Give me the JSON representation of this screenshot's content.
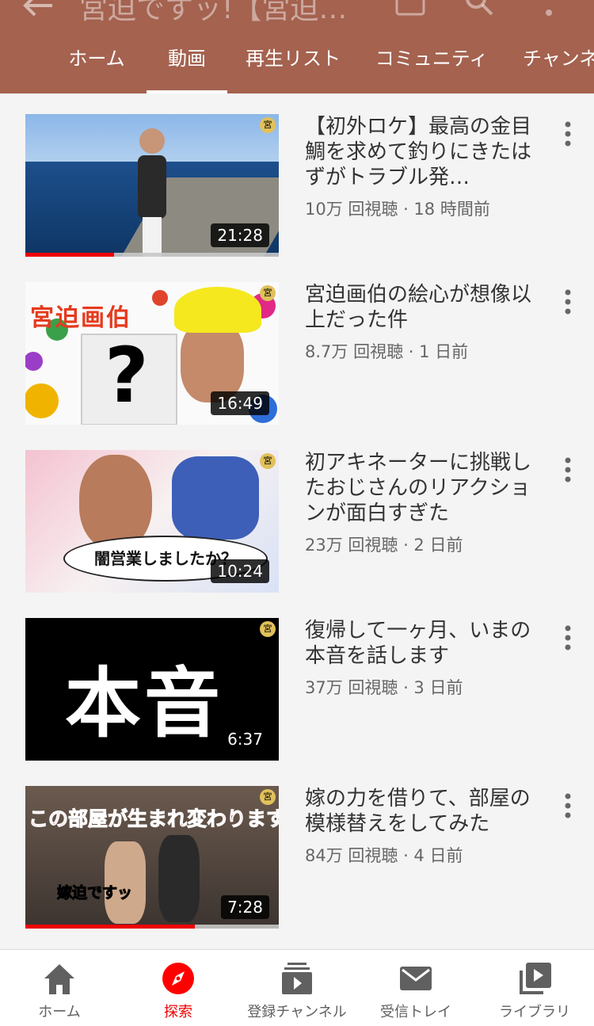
{
  "header": {
    "title": "宮迫ですッ!【宮迫…",
    "tabs": [
      {
        "label": "ホーム",
        "active": false
      },
      {
        "label": "動画",
        "active": true
      },
      {
        "label": "再生リスト",
        "active": false
      },
      {
        "label": "コミュニティ",
        "active": false
      },
      {
        "label": "チャンネル",
        "active": false
      }
    ],
    "icons": [
      "arrow-back-icon",
      "cast-icon",
      "search-icon",
      "more-vert-icon"
    ],
    "bg_color": "#a4624f"
  },
  "videos": [
    {
      "title": "【初外ロケ】最高の金目鯛を求めて釣りにきたはずがトラブル発…",
      "meta": "10万 回視聴 · 18 時間前",
      "duration": "21:28",
      "progress": 0.35,
      "badge": "宮"
    },
    {
      "title": "宮迫画伯の絵心が想像以上だった件",
      "meta": "8.7万 回視聴 · 1 日前",
      "duration": "16:49",
      "thumb_text": "宮迫画伯",
      "thumb_glyph": "?",
      "badge": "宮"
    },
    {
      "title": "初アキネーターに挑戦したおじさんのリアクションが面白すぎた",
      "meta": "23万 回視聴 · 2 日前",
      "duration": "10:24",
      "thumb_text": "闇営業しましたか？",
      "badge": "宮"
    },
    {
      "title": "復帰して一ヶ月、いまの本音を話します",
      "meta": "37万 回視聴 · 3 日前",
      "duration": "6:37",
      "thumb_text": "本音",
      "badge": "宮"
    },
    {
      "title": "嫁の力を借りて、部屋の模様替えをしてみた",
      "meta": "84万 回視聴 · 4 日前",
      "duration": "7:28",
      "progress": 0.67,
      "thumb_text": "この部屋が生まれ変わります",
      "thumb_label": "嫁迫ですッ",
      "badge": "宮"
    }
  ],
  "bottom_nav": [
    {
      "label": "ホーム",
      "icon": "home-icon",
      "active": false
    },
    {
      "label": "探索",
      "icon": "explore-icon",
      "active": true
    },
    {
      "label": "登録チャンネル",
      "icon": "subscriptions-icon",
      "active": false
    },
    {
      "label": "受信トレイ",
      "icon": "inbox-icon",
      "active": false
    },
    {
      "label": "ライブラリ",
      "icon": "library-icon",
      "active": false
    }
  ],
  "colors": {
    "accent": "#ff0000",
    "text": "#333333",
    "meta": "#666666"
  }
}
